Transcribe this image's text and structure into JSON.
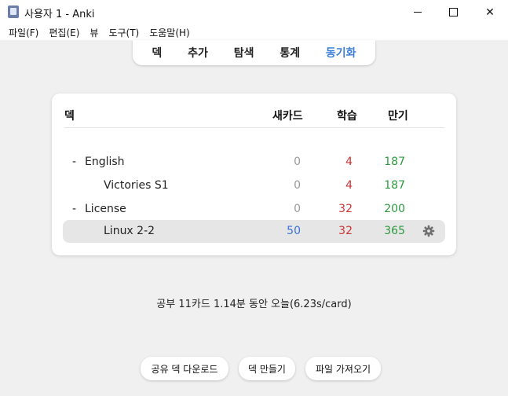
{
  "window": {
    "title": "사용자 1 - Anki",
    "minimize_icon": "minimize-icon",
    "maximize_icon": "maximize-icon",
    "close_label": "✕"
  },
  "menu": {
    "items": [
      "파일(F)",
      "편집(E)",
      "뷰",
      "도구(T)",
      "도움말(H)"
    ]
  },
  "toptabs": {
    "items": [
      "덱",
      "추가",
      "탐색",
      "통계",
      "동기화"
    ],
    "active_color": "#3b7fd9"
  },
  "deck_table": {
    "headers": {
      "deck": "덱",
      "new": "새카드",
      "learn": "학습",
      "due": "만기"
    },
    "rows": [
      {
        "collapse": "-",
        "name": "English",
        "new": "0",
        "learn": "4",
        "due": "187"
      },
      {
        "collapse": "",
        "name": "Victories S1",
        "new": "0",
        "learn": "4",
        "due": "187"
      },
      {
        "collapse": "-",
        "name": "License",
        "new": "0",
        "learn": "32",
        "due": "200"
      },
      {
        "collapse": "",
        "name": "Linux 2-2",
        "new": "50",
        "learn": "32",
        "due": "365"
      }
    ],
    "colors": {
      "zero": "#9a9a9a",
      "new": "#3a73d8",
      "learn": "#cc3333",
      "due": "#2b9a3e"
    }
  },
  "studied_text": "공부 11카드 1.14분 동안 오늘(6.23s/card)",
  "buttons": {
    "shared": "공유 덱 다운로드",
    "create": "덱 만들기",
    "import": "파일 가져오기"
  }
}
